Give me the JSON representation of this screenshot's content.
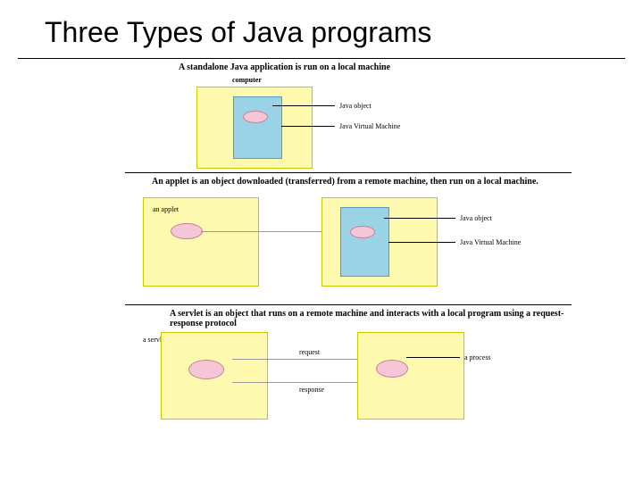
{
  "title": "Three Types of Java programs",
  "section1": {
    "heading": "A standalone Java application is run on a local machine",
    "computer_label": "computer",
    "java_object_label": "Java object",
    "jvm_label": "Java Virtual Machine"
  },
  "section2": {
    "heading": "An applet is an object downloaded (transferred) from a remote machine, then run on a local machine.",
    "applet_label": "an applet",
    "java_object_label": "Java object",
    "jvm_label": "Java Virtual Machine"
  },
  "section3": {
    "heading": "A servlet is an object that runs on a remote machine and interacts with a local program using a request-response protocol",
    "servlet_label": "a servlet",
    "request_label": "request",
    "response_label": "response",
    "process_label": "a process"
  }
}
